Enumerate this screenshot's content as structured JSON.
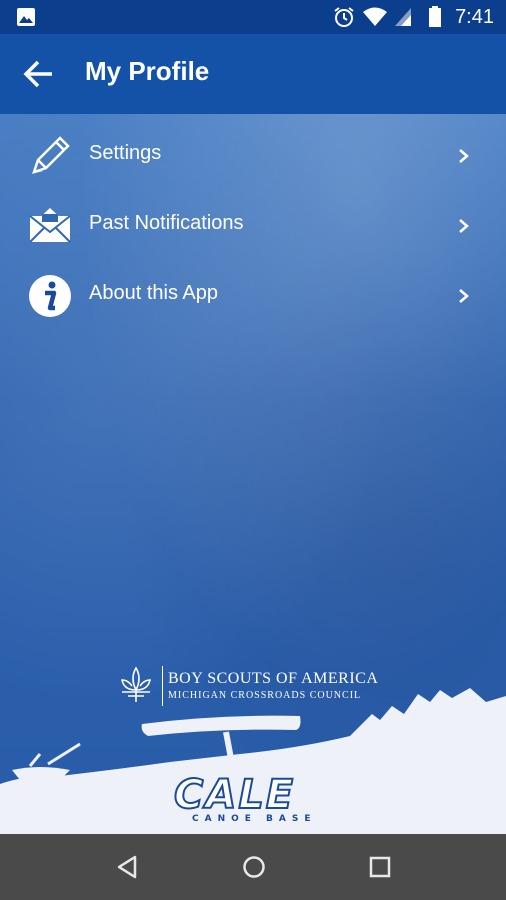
{
  "status_bar": {
    "time": "7:41",
    "icons": [
      "image-icon",
      "alarm-icon",
      "wifi-icon",
      "signal-icon",
      "battery-icon"
    ]
  },
  "app_bar": {
    "title": "My Profile",
    "back_icon": "arrow-back-icon"
  },
  "menu": {
    "items": [
      {
        "label": "Settings",
        "icon": "pencil-icon"
      },
      {
        "label": "Past Notifications",
        "icon": "envelope-icon"
      },
      {
        "label": "About this App",
        "icon": "info-icon"
      }
    ]
  },
  "branding": {
    "org_name": "BOY SCOUTS OF AMERICA",
    "council": "MICHIGAN CROSSROADS COUNCIL",
    "logo": "CALE",
    "logo_sub": "CANOE BASE"
  },
  "nav_bar": {
    "buttons": [
      "back-triangle-icon",
      "home-circle-icon",
      "recents-square-icon"
    ]
  },
  "colors": {
    "status_bar": "#0b3f8e",
    "app_bar": "#1452a8",
    "background": "#2f67b2",
    "nav_bar": "#4a4a4a"
  }
}
